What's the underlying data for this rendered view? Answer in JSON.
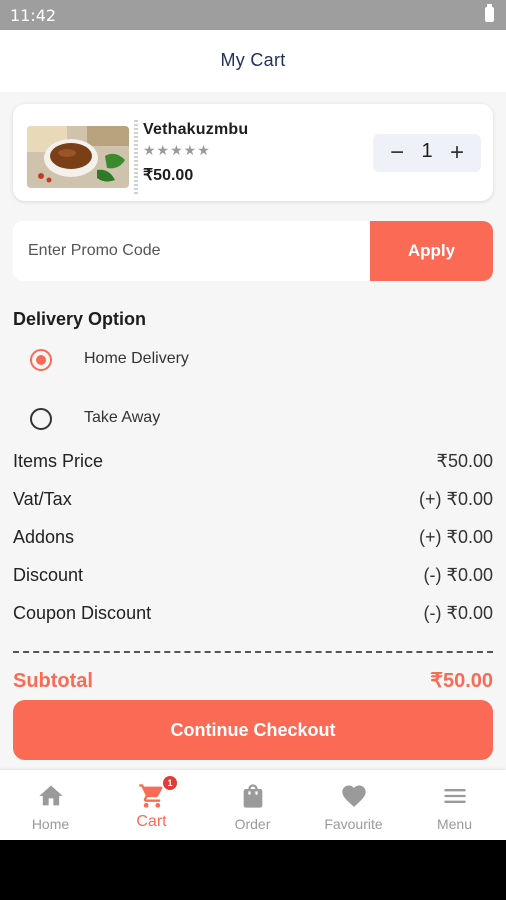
{
  "status_bar": {
    "time": "11:42"
  },
  "app_bar": {
    "title": "My Cart"
  },
  "cart_item": {
    "name": "Vethakuzmbu",
    "rating_stars": "★★★★★",
    "rating": 0,
    "price": "₹50.00",
    "quantity": "1",
    "minus_symbol": "−",
    "plus_symbol": "+"
  },
  "promo": {
    "placeholder": "Enter Promo Code",
    "apply_label": "Apply"
  },
  "delivery": {
    "title": "Delivery Option",
    "options": [
      {
        "label": "Home Delivery",
        "selected": true
      },
      {
        "label": "Take Away",
        "selected": false
      }
    ]
  },
  "summary": [
    {
      "label": "Items Price",
      "value": "₹50.00"
    },
    {
      "label": "Vat/Tax",
      "value": "(+) ₹0.00"
    },
    {
      "label": "Addons",
      "value": "(+) ₹0.00"
    },
    {
      "label": "Discount",
      "value": "(-) ₹0.00"
    },
    {
      "label": "Coupon Discount",
      "value": "(-) ₹0.00"
    }
  ],
  "subtotal": {
    "label": "Subtotal",
    "value": "₹50.00"
  },
  "checkout": {
    "label": "Continue Checkout"
  },
  "nav": {
    "items": [
      {
        "label": "Home",
        "icon": "home-icon"
      },
      {
        "label": "Cart",
        "icon": "cart-icon",
        "badge": "1",
        "active": true
      },
      {
        "label": "Order",
        "icon": "bag-icon"
      },
      {
        "label": "Favourite",
        "icon": "heart-icon"
      },
      {
        "label": "Menu",
        "icon": "menu-icon"
      }
    ]
  },
  "colors": {
    "accent": "#fa6a55",
    "title": "#22305a",
    "badge": "#e53935",
    "inactive": "#9a9a9a"
  }
}
